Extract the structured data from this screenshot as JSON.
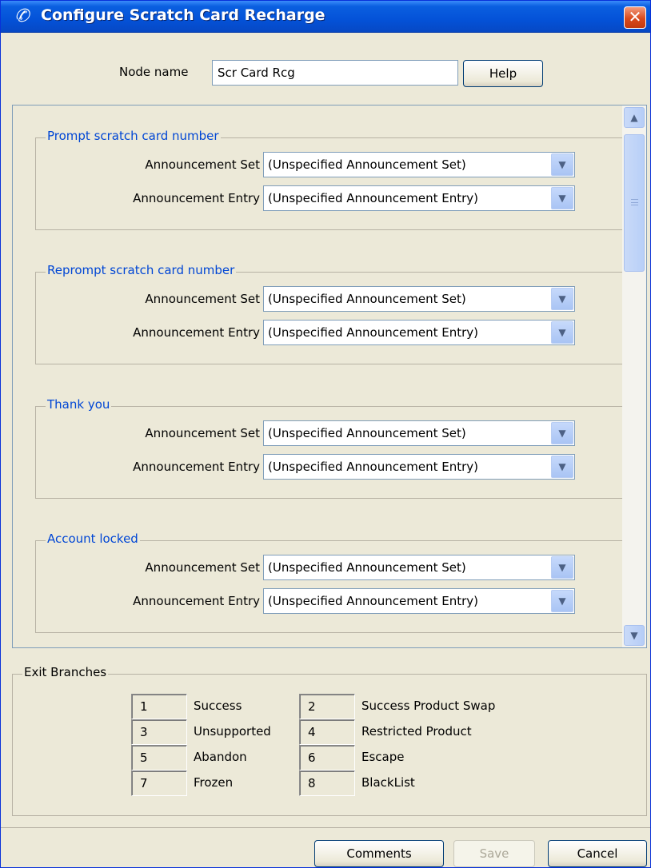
{
  "window": {
    "title": "Configure Scratch Card Recharge",
    "close_glyph": "✕"
  },
  "node": {
    "label": "Node name",
    "value": "Scr Card Rcg",
    "help_label": "Help"
  },
  "sections": [
    {
      "title": "Prompt scratch card number",
      "set_label": "Announcement Set",
      "set_value": "(Unspecified Announcement Set)",
      "entry_label": "Announcement Entry",
      "entry_value": "(Unspecified Announcement Entry)"
    },
    {
      "title": "Reprompt scratch card number",
      "set_label": "Announcement Set",
      "set_value": "(Unspecified Announcement Set)",
      "entry_label": "Announcement Entry",
      "entry_value": "(Unspecified Announcement Entry)"
    },
    {
      "title": "Thank you",
      "set_label": "Announcement Set",
      "set_value": "(Unspecified Announcement Set)",
      "entry_label": "Announcement Entry",
      "entry_value": "(Unspecified Announcement Entry)"
    },
    {
      "title": "Account locked",
      "set_label": "Announcement Set",
      "set_value": "(Unspecified Announcement Set)",
      "entry_label": "Announcement Entry",
      "entry_value": "(Unspecified Announcement Entry)"
    }
  ],
  "exit_branches": {
    "title": "Exit Branches",
    "items": [
      {
        "num": "1",
        "label": "Success"
      },
      {
        "num": "2",
        "label": "Success Product Swap"
      },
      {
        "num": "3",
        "label": "Unsupported"
      },
      {
        "num": "4",
        "label": "Restricted Product"
      },
      {
        "num": "5",
        "label": "Abandon"
      },
      {
        "num": "6",
        "label": "Escape"
      },
      {
        "num": "7",
        "label": "Frozen"
      },
      {
        "num": "8",
        "label": "BlackList"
      }
    ]
  },
  "footer": {
    "comments_label": "Comments",
    "save_label": "Save",
    "cancel_label": "Cancel"
  },
  "icons": {
    "title_icon": "phone-handset-icon",
    "combo_arrow": "chevron-down-icon",
    "scroll_up": "chevron-up-icon",
    "scroll_down": "chevron-down-icon"
  },
  "colors": {
    "titlebar": "#0452d8",
    "group_title": "#0046d5",
    "close": "#d9491c",
    "dialog_bg": "#ece9d8"
  }
}
